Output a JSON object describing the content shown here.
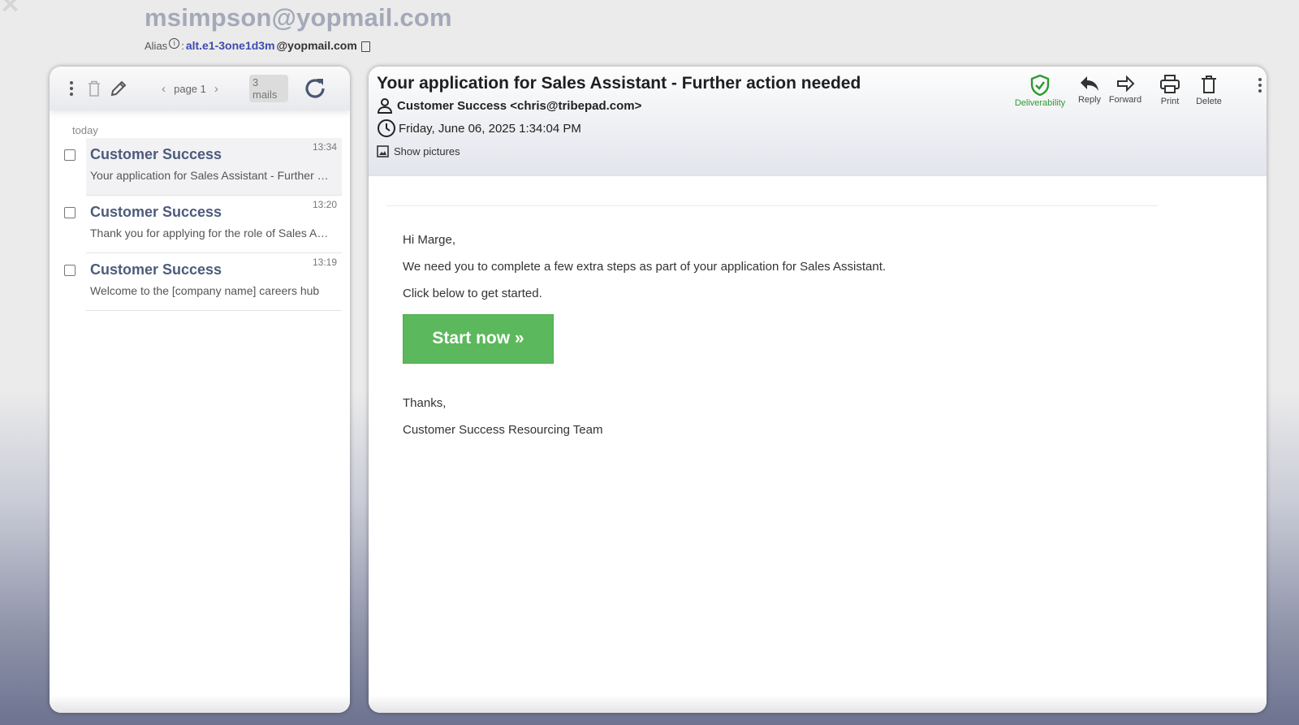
{
  "header": {
    "account_email": "msimpson@yopmail.com",
    "alias_label": "Alias",
    "alias_separator": ":",
    "alias_value": "alt.e1-3one1d3m",
    "alias_domain": "@yopmail.com"
  },
  "inbox": {
    "page_label": "page 1",
    "mail_count": "3 mails",
    "day_label": "today",
    "mails": [
      {
        "from": "Customer Success",
        "time": "13:34",
        "subject": "Your application for Sales Assistant - Further action needed",
        "selected": true
      },
      {
        "from": "Customer Success",
        "time": "13:20",
        "subject": "Thank you for applying for the role of Sales Assistant",
        "selected": false
      },
      {
        "from": "Customer Success",
        "time": "13:19",
        "subject": "Welcome to the [company name] careers hub",
        "selected": false
      }
    ]
  },
  "message": {
    "subject": "Your application for Sales Assistant - Further action needed",
    "from": "Customer Success <chris@tribepad.com>",
    "date": "Friday, June 06, 2025 1:34:04 PM",
    "show_pictures": "Show pictures",
    "actions": {
      "deliverability": "Deliverability",
      "reply": "Reply",
      "forward": "Forward",
      "print": "Print",
      "delete": "Delete"
    },
    "accent_green": "#2e9a2e",
    "body": {
      "greeting": "Hi Marge,",
      "line1": "We need you to complete a few extra steps as part of your application for Sales Assistant.",
      "line2": "Click below to get started.",
      "button": "Start now »",
      "button_color": "#5cb85c",
      "closing": "Thanks,",
      "signature": "Customer Success Resourcing Team"
    }
  }
}
